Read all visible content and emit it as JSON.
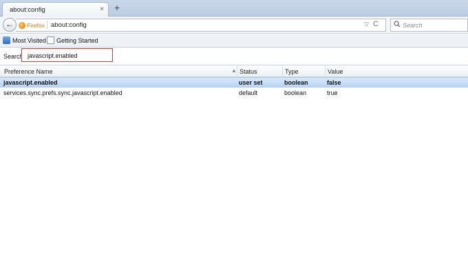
{
  "tab": {
    "title": "about:config",
    "close": "×",
    "new_tab": "+"
  },
  "navbar": {
    "back": "←",
    "identity_label": "Firefox",
    "url": "about:config",
    "url_arrow": "▽",
    "reload": "C",
    "search_placeholder": "Search",
    "search_icon": "search-icon"
  },
  "bookmarks": [
    {
      "label": "Most Visited",
      "icon": "most-visited-icon"
    },
    {
      "label": "Getting Started",
      "icon": "page-icon"
    }
  ],
  "config": {
    "search_label": "Search:",
    "search_value": "javascript.enabled"
  },
  "table": {
    "columns": [
      "Preference Name",
      "Status",
      "Type",
      "Value"
    ],
    "sort_indicator": "▲",
    "rows": [
      {
        "name": "javascript.enabled",
        "status": "user set",
        "type": "boolean",
        "value": "false",
        "modified": true
      },
      {
        "name": "services.sync.prefs.sync.javascript.enabled",
        "status": "default",
        "type": "boolean",
        "value": "true",
        "modified": false
      }
    ]
  },
  "colors": {
    "highlight_border": "#e0332e",
    "selected_row": "#bad6f6"
  }
}
